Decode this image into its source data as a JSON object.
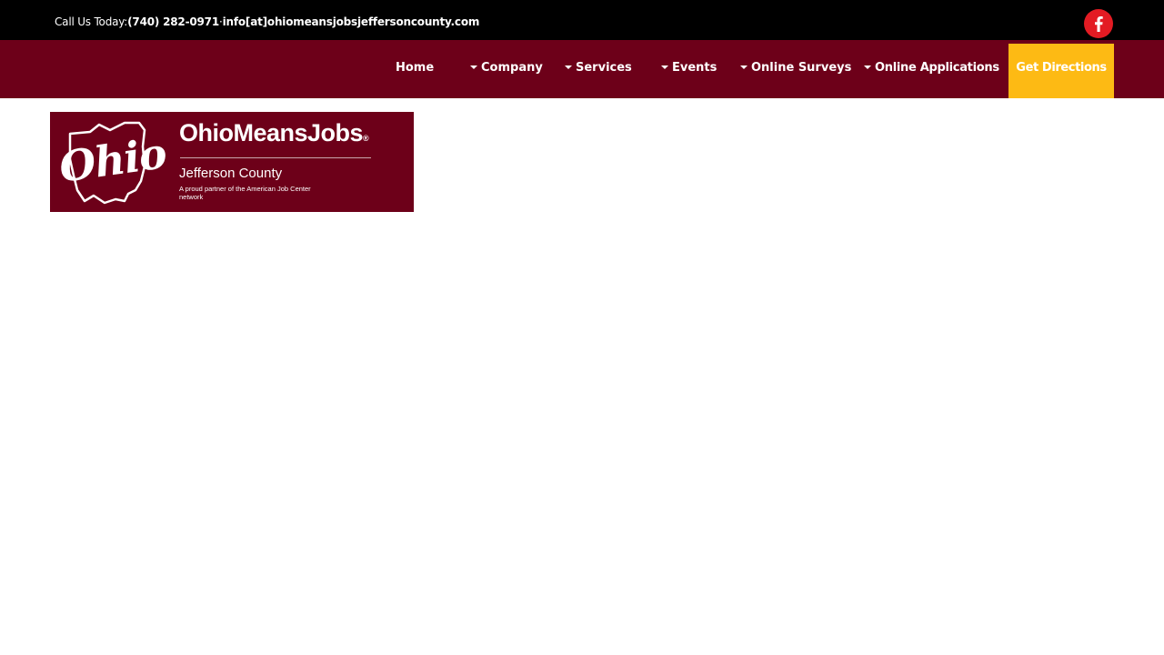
{
  "colors": {
    "topbar": "#000000",
    "navbar": "#6d0019",
    "cta": "#fdba14",
    "facebook": "#e31b23",
    "logo_bg": "#6d0019"
  },
  "contact": {
    "label": "Call Us Today:",
    "phone": "(740) 282-0971",
    "separator": "·",
    "email": "info[at]ohiomeansjobsjeffersoncounty.com"
  },
  "social": {
    "facebook_icon": "facebook-icon"
  },
  "nav": {
    "home": "Home",
    "company": "Company",
    "services": "Services",
    "events": "Events",
    "surveys": "Online Surveys",
    "applications": "Online Applications",
    "directions": "Get Directions"
  },
  "logo": {
    "script": "Ohio",
    "title": "OhioMeansJobs",
    "registered": "®",
    "county": "Jefferson County",
    "tagline": "A proud partner of the American Job Center network"
  }
}
